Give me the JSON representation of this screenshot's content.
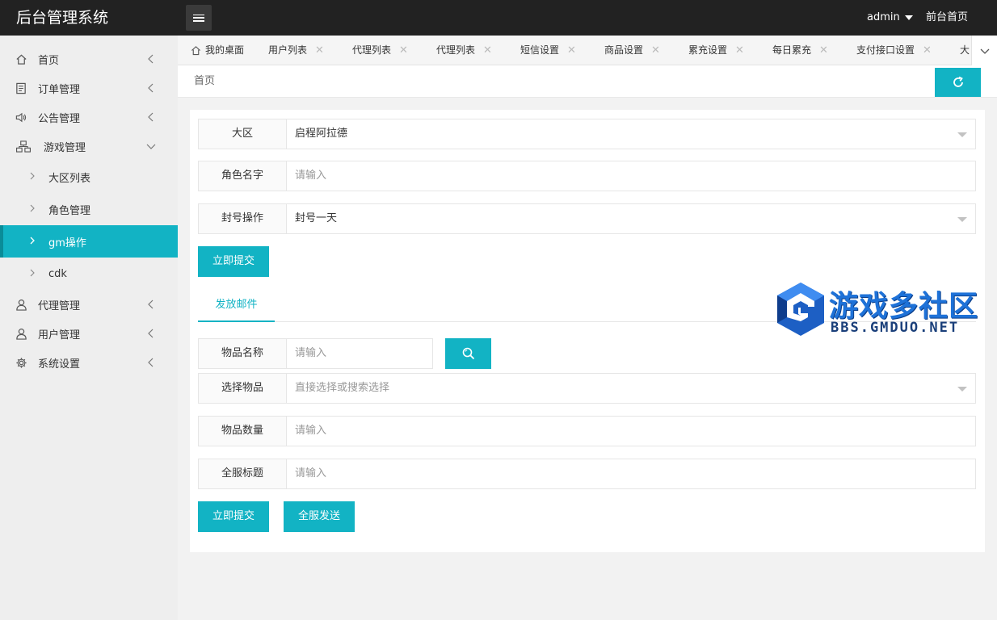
{
  "header": {
    "title": "后台管理系统",
    "user": "admin",
    "home_link": "前台首页"
  },
  "sidebar": {
    "items": [
      {
        "label": "首页",
        "icon": "home-icon"
      },
      {
        "label": "订单管理",
        "icon": "document-icon"
      },
      {
        "label": "公告管理",
        "icon": "speaker-icon"
      },
      {
        "label": "游戏管理",
        "icon": "sitemap-icon",
        "expanded": true,
        "children": [
          {
            "label": "大区列表"
          },
          {
            "label": "角色管理"
          },
          {
            "label": "gm操作",
            "active": true
          },
          {
            "label": "cdk"
          }
        ]
      },
      {
        "label": "代理管理",
        "icon": "user-icon"
      },
      {
        "label": "用户管理",
        "icon": "user-icon"
      },
      {
        "label": "系统设置",
        "icon": "gear-icon"
      }
    ]
  },
  "tabs": [
    {
      "label": "我的桌面"
    },
    {
      "label": "用户列表"
    },
    {
      "label": "代理列表"
    },
    {
      "label": "代理列表"
    },
    {
      "label": "短信设置"
    },
    {
      "label": "商品设置"
    },
    {
      "label": "累充设置"
    },
    {
      "label": "每日累充"
    },
    {
      "label": "支付接口设置"
    },
    {
      "label": "大"
    }
  ],
  "breadcrumb": "首页",
  "form1": {
    "region_label": "大区",
    "region_value": "启程阿拉德",
    "role_label": "角色名字",
    "role_placeholder": "请输入",
    "ban_label": "封号操作",
    "ban_value": "封号一天",
    "submit_label": "立即提交"
  },
  "mail": {
    "tab_label": "发放邮件",
    "item_name_label": "物品名称",
    "item_name_placeholder": "请输入",
    "select_item_label": "选择物品",
    "select_item_placeholder": "直接选择或搜索选择",
    "quantity_label": "物品数量",
    "quantity_placeholder": "请输入",
    "title_label": "全服标题",
    "title_placeholder": "请输入",
    "submit_label": "立即提交",
    "send_all_label": "全服发送"
  },
  "watermark": {
    "text": "游戏多社区",
    "url": "BBS.GMDUO.NET"
  },
  "colors": {
    "accent": "#12b3c4",
    "header_bg": "#222222",
    "sidebar_bg": "#eeeeee"
  }
}
